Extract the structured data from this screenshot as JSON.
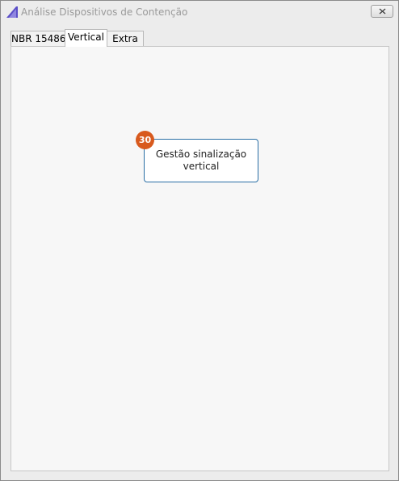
{
  "window": {
    "title": "Análise Dispositivos de Contenção",
    "icon": "app-logo-icon",
    "close_icon": "close-icon"
  },
  "tabs": [
    {
      "label": "NBR 15486",
      "active": false
    },
    {
      "label": "Vertical",
      "active": true
    },
    {
      "label": "Extra",
      "active": false
    }
  ],
  "diagram": {
    "nodes": [
      {
        "label": "Gestão sinalização vertical",
        "badge": "30"
      }
    ]
  },
  "colors": {
    "badge": "#d85a1e",
    "node_border": "#2a6fa5",
    "app_icon": "#5b4fc7"
  }
}
